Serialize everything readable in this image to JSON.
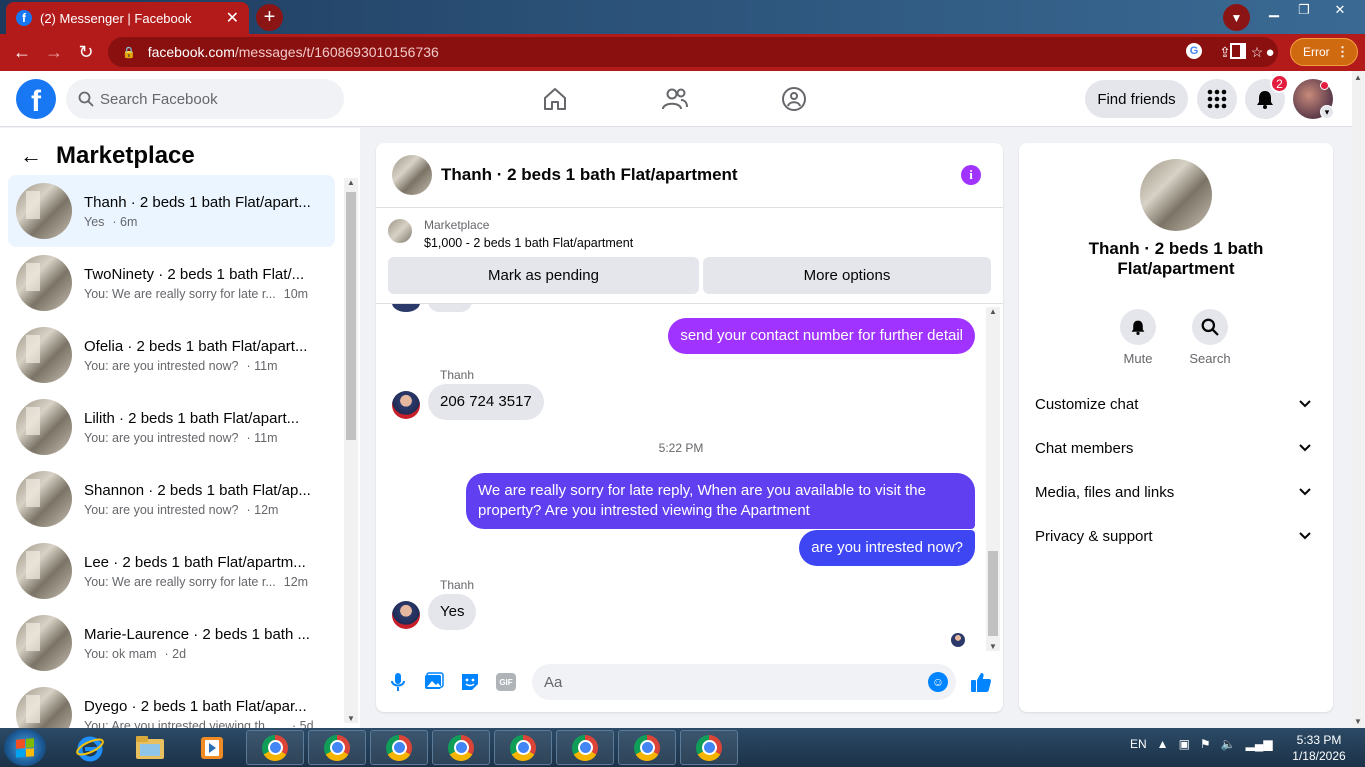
{
  "browser": {
    "tab_title": "(2) Messenger | Facebook",
    "url_host": "facebook.com",
    "url_path": "/messages/t/1608693010156736",
    "error_label": "Error"
  },
  "fb_nav": {
    "search_placeholder": "Search Facebook",
    "find_friends_label": "Find friends",
    "notification_count": "2"
  },
  "left_pane": {
    "title": "Marketplace",
    "conversations": [
      {
        "name": "Thanh · 2 beds 1 bath Flat/apart...",
        "snippet": "Yes",
        "time": "· 6m",
        "active": true
      },
      {
        "name": "TwoNinety · 2 beds 1 bath Flat/...",
        "snippet": "You: We are really sorry for late r...",
        "time": "10m"
      },
      {
        "name": "Ofelia · 2 beds 1 bath Flat/apart...",
        "snippet": "You: are you intrested now?",
        "time": "· 11m"
      },
      {
        "name": "Lilith · 2 beds 1 bath Flat/apart...",
        "snippet": "You: are you intrested now?",
        "time": "· 11m"
      },
      {
        "name": "Shannon · 2 beds 1 bath Flat/ap...",
        "snippet": "You: are you intrested now?",
        "time": "· 12m"
      },
      {
        "name": "Lee · 2 beds 1 bath Flat/apartm...",
        "snippet": "You: We are really sorry for late r...",
        "time": "12m"
      },
      {
        "name": "Marie-Laurence · 2 beds 1 bath ...",
        "snippet": "You: ok mam",
        "time": "· 2d"
      },
      {
        "name": "Dyego · 2 beds 1 bath Flat/apar...",
        "snippet": "You: Are you intrested viewing the ...",
        "time": "· 5d"
      }
    ]
  },
  "chat": {
    "title": "Thanh · 2 beds 1 bath Flat/apartment",
    "listing_label": "Marketplace",
    "listing_detail": "$1,000 - 2 beds 1 bath Flat/apartment",
    "mark_pending_label": "Mark as pending",
    "more_options_label": "More options",
    "msg_out_1": "send your contact number for further detail",
    "sender_1": "Thanh",
    "msg_in_1": "206 724 3517",
    "timestamp": "5:22 PM",
    "msg_out_2": "We are really sorry for late reply, When are you available to visit the property? Are you intrested viewing the Apartment",
    "msg_out_3": "are you intrested now?",
    "sender_2": "Thanh",
    "msg_in_2": "Yes",
    "composer_placeholder": "Aa",
    "gif_label": "GIF"
  },
  "right_pane": {
    "name": "Thanh · 2 beds 1 bath Flat/apartment",
    "mute_label": "Mute",
    "search_label": "Search",
    "rows": [
      "Customize chat",
      "Chat members",
      "Media, files and links",
      "Privacy & support"
    ]
  },
  "taskbar": {
    "lang": "EN",
    "time": "5:33 PM",
    "date": "1/18/2026"
  },
  "colors": {
    "browser_red": "#b31b1b",
    "fb_blue": "#1877f2",
    "bubble_purple": "#a033ff",
    "bubble_indigo": "#5f3ff0",
    "bubble_blue": "#3e45f2"
  }
}
